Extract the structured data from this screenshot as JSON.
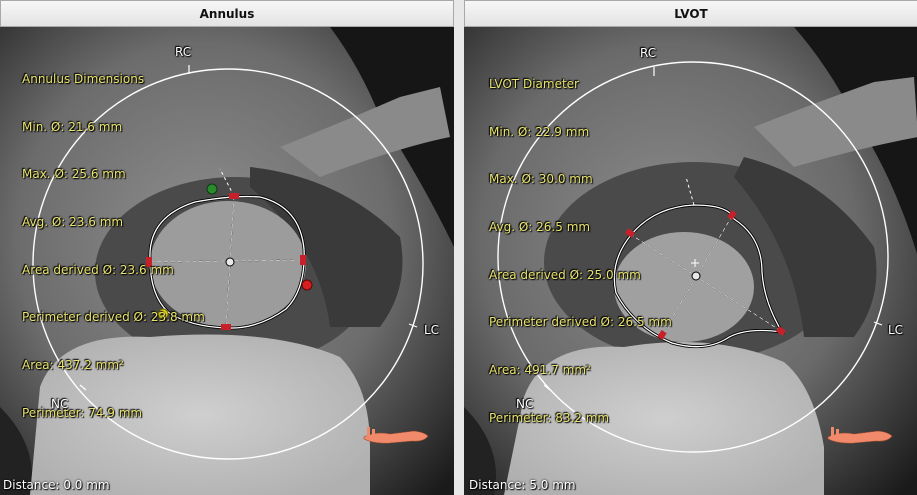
{
  "panels": {
    "left": {
      "title": "Annulus",
      "measurements": [
        "Annulus Dimensions",
        "Min. Ø: 21.6 mm",
        "Max. Ø: 25.6 mm",
        "Avg. Ø: 23.6 mm",
        "Area derived Ø: 23.6 mm",
        "Perimeter derived Ø: 23.8 mm",
        "Area: 437.2 mm²",
        "Perimeter: 74.9 mm"
      ],
      "labels": {
        "rc": "RC",
        "lc": "LC",
        "nc": "NC"
      },
      "distance": "Distance: 0.0 mm",
      "markers": {
        "green": "#2a8a2e",
        "red": "#d81e1e",
        "yellow": "#e8d81a"
      }
    },
    "right": {
      "title": "LVOT",
      "measurements": [
        "LVOT Diameter",
        "Min. Ø: 22.9 mm",
        "Max. Ø: 30.0 mm",
        "Avg. Ø: 26.5 mm",
        "Area derived Ø: 25.0 mm",
        "Perimeter derived Ø: 26.5 mm",
        "Area: 491.7 mm²",
        "Perimeter: 83.2 mm"
      ],
      "labels": {
        "rc": "RC",
        "lc": "LC",
        "nc": "NC"
      },
      "distance": "Distance: 5.0 mm"
    }
  },
  "colors": {
    "overlay_text": "#e9e46e",
    "ring": "#ffffff",
    "handle": "#c8202a",
    "orientation_figure": "#f08a6a"
  }
}
